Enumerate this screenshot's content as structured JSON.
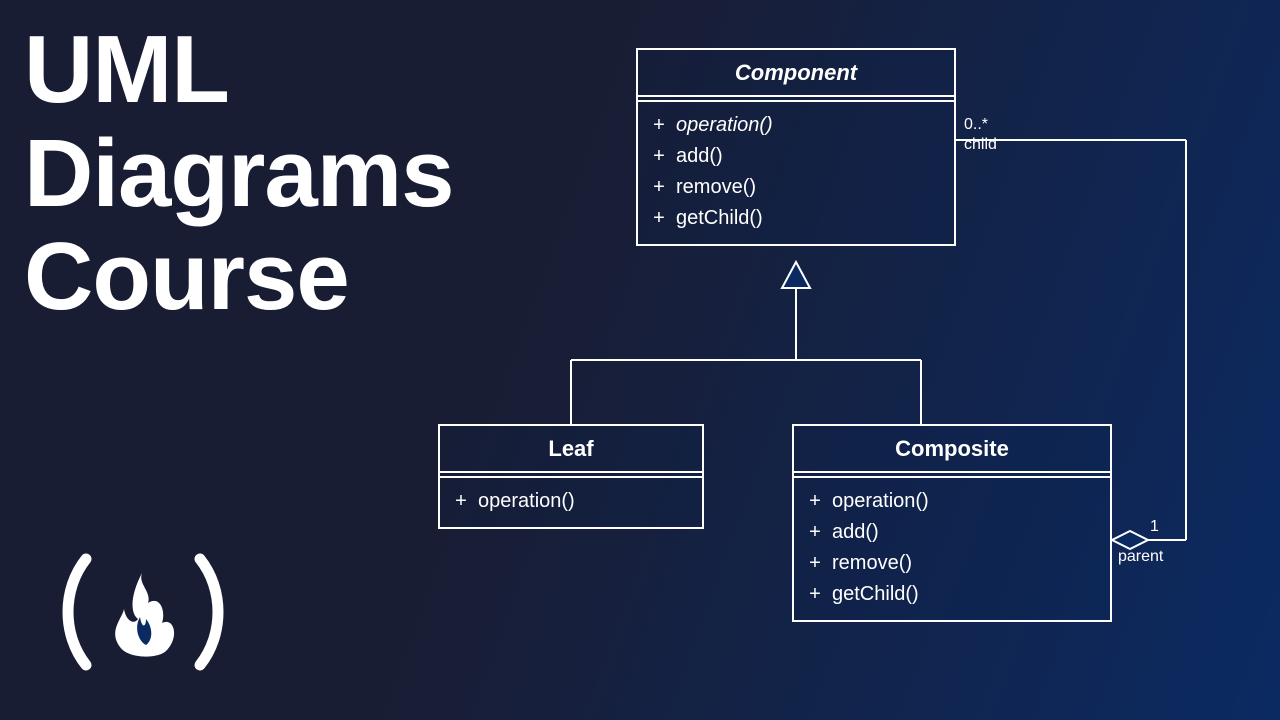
{
  "title": {
    "line1": "UML",
    "line2": "Diagrams",
    "line3": "Course"
  },
  "diagram": {
    "classes": {
      "component": {
        "name": "Component",
        "italic": true,
        "operations": [
          {
            "vis": "+",
            "name": "operation()",
            "italic": true
          },
          {
            "vis": "+",
            "name": "add()"
          },
          {
            "vis": "+",
            "name": "remove()"
          },
          {
            "vis": "+",
            "name": "getChild()"
          }
        ]
      },
      "leaf": {
        "name": "Leaf",
        "operations": [
          {
            "vis": "+",
            "name": "operation()"
          }
        ]
      },
      "composite": {
        "name": "Composite",
        "operations": [
          {
            "vis": "+",
            "name": "operation()"
          },
          {
            "vis": "+",
            "name": "add()"
          },
          {
            "vis": "+",
            "name": "remove()"
          },
          {
            "vis": "+",
            "name": "getChild()"
          }
        ]
      }
    },
    "relations": {
      "generalization": {
        "parent": "Component",
        "children": [
          "Leaf",
          "Composite"
        ]
      },
      "aggregation": {
        "whole": "Composite",
        "part": "Component",
        "wholeLabel": "parent",
        "wholeMult": "1",
        "partLabel": "child",
        "partMult": "0..*"
      }
    }
  }
}
